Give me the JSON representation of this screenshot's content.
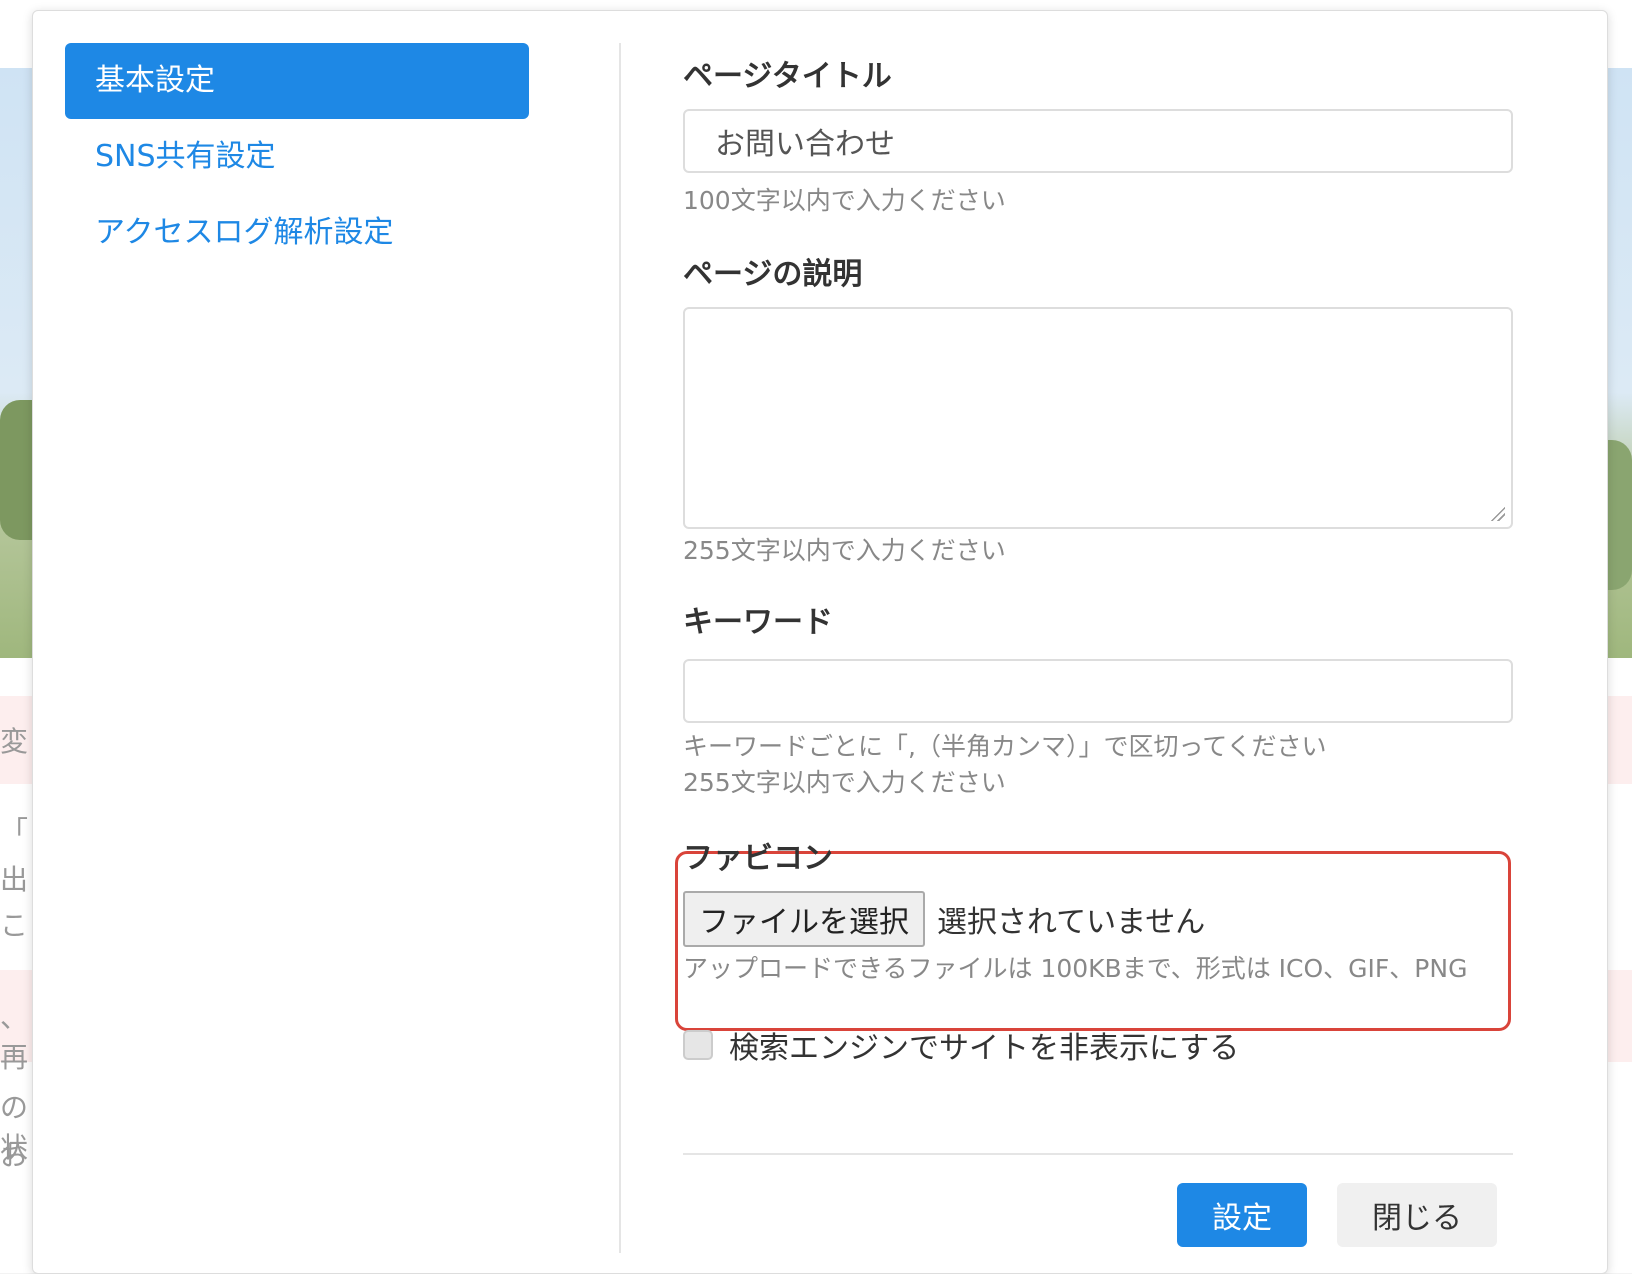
{
  "background": {
    "fragments": [
      "変",
      "「こ",
      "出",
      "こ",
      "、再",
      "の状",
      "お"
    ]
  },
  "sidebar": {
    "items": [
      {
        "label": "基本設定",
        "active": true
      },
      {
        "label": "SNS共有設定",
        "active": false
      },
      {
        "label": "アクセスログ解析設定",
        "active": false
      }
    ]
  },
  "form": {
    "title": {
      "label": "ページタイトル",
      "value": "お問い合わせ",
      "help": "100文字以内で入力ください"
    },
    "description": {
      "label": "ページの説明",
      "value": "",
      "help": "255文字以内で入力ください"
    },
    "keywords": {
      "label": "キーワード",
      "value": "",
      "help1": "キーワードごとに「,（半角カンマ）」で区切ってください",
      "help2": "255文字以内で入力ください"
    },
    "favicon": {
      "label": "ファビコン",
      "button": "ファイルを選択",
      "status": "選択されていません",
      "help": "アップロードできるファイルは 100KBまで、形式は ICO、GIF、PNG"
    },
    "hide_search": {
      "label": "検索エンジンでサイトを非表示にする",
      "checked": false
    }
  },
  "footer": {
    "submit": "設定",
    "close": "閉じる"
  },
  "colors": {
    "accent": "#1e88e5",
    "highlight_border": "#d9443a"
  }
}
